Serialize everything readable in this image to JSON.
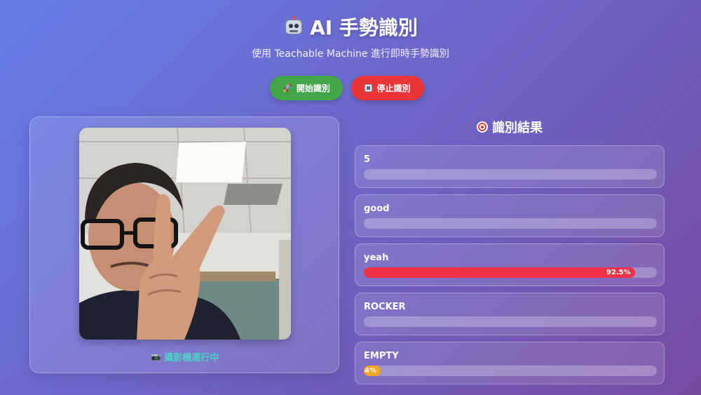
{
  "header": {
    "title": "AI 手勢識別",
    "subtitle": "使用 Teachable Machine 進行即時手勢識別"
  },
  "controls": {
    "start_label": "開始識別",
    "stop_label": "停止識別",
    "start_icon": "rocket-icon",
    "stop_icon": "stop-icon"
  },
  "camera": {
    "status": "攝影機運行中",
    "status_icon": "camera-icon"
  },
  "results": {
    "title": "識別結果",
    "title_icon": "target-icon",
    "items": [
      {
        "label": "5",
        "value": 0,
        "value_label": ""
      },
      {
        "label": "good",
        "value": 0,
        "value_label": ""
      },
      {
        "label": "yeah",
        "value": 0.925,
        "value_label": "92.5%",
        "color": "#ef3246"
      },
      {
        "label": "ROCKER",
        "value": 0,
        "value_label": ""
      },
      {
        "label": "EMPTY",
        "value": 0.04,
        "value_label": "4%",
        "color": "#f5a623"
      }
    ]
  },
  "colors": {
    "accent_start": "#43a649",
    "accent_stop": "#ea3437",
    "status": "#4fd1c5",
    "bg_from": "#667eea",
    "bg_to": "#764ba2"
  }
}
